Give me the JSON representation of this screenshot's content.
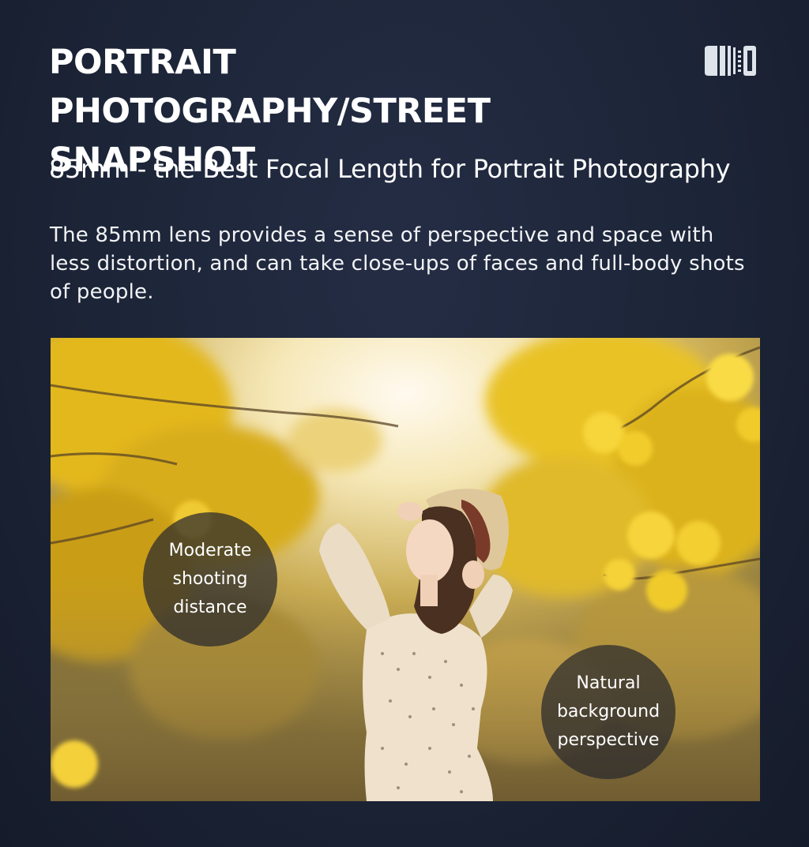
{
  "header": {
    "title": "PORTRAIT PHOTOGRAPHY/STREET SNAPSHOT",
    "logo_icon": "lens-mount-icon"
  },
  "subtitle": "85mm - the Best Focal Length for Portrait Photography",
  "description": "The 85mm lens provides a sense of perspective and space with less distortion, and can take close-ups of faces and full-body shots of people.",
  "photo": {
    "annotations": [
      {
        "label": "Moderate\nshooting\ndistance"
      },
      {
        "label": "Natural\nbackground\nperspective"
      }
    ]
  },
  "colors": {
    "background": "#1c2437",
    "text": "#ffffff",
    "bubble": "#28282c",
    "foliage": "#e8c020"
  }
}
